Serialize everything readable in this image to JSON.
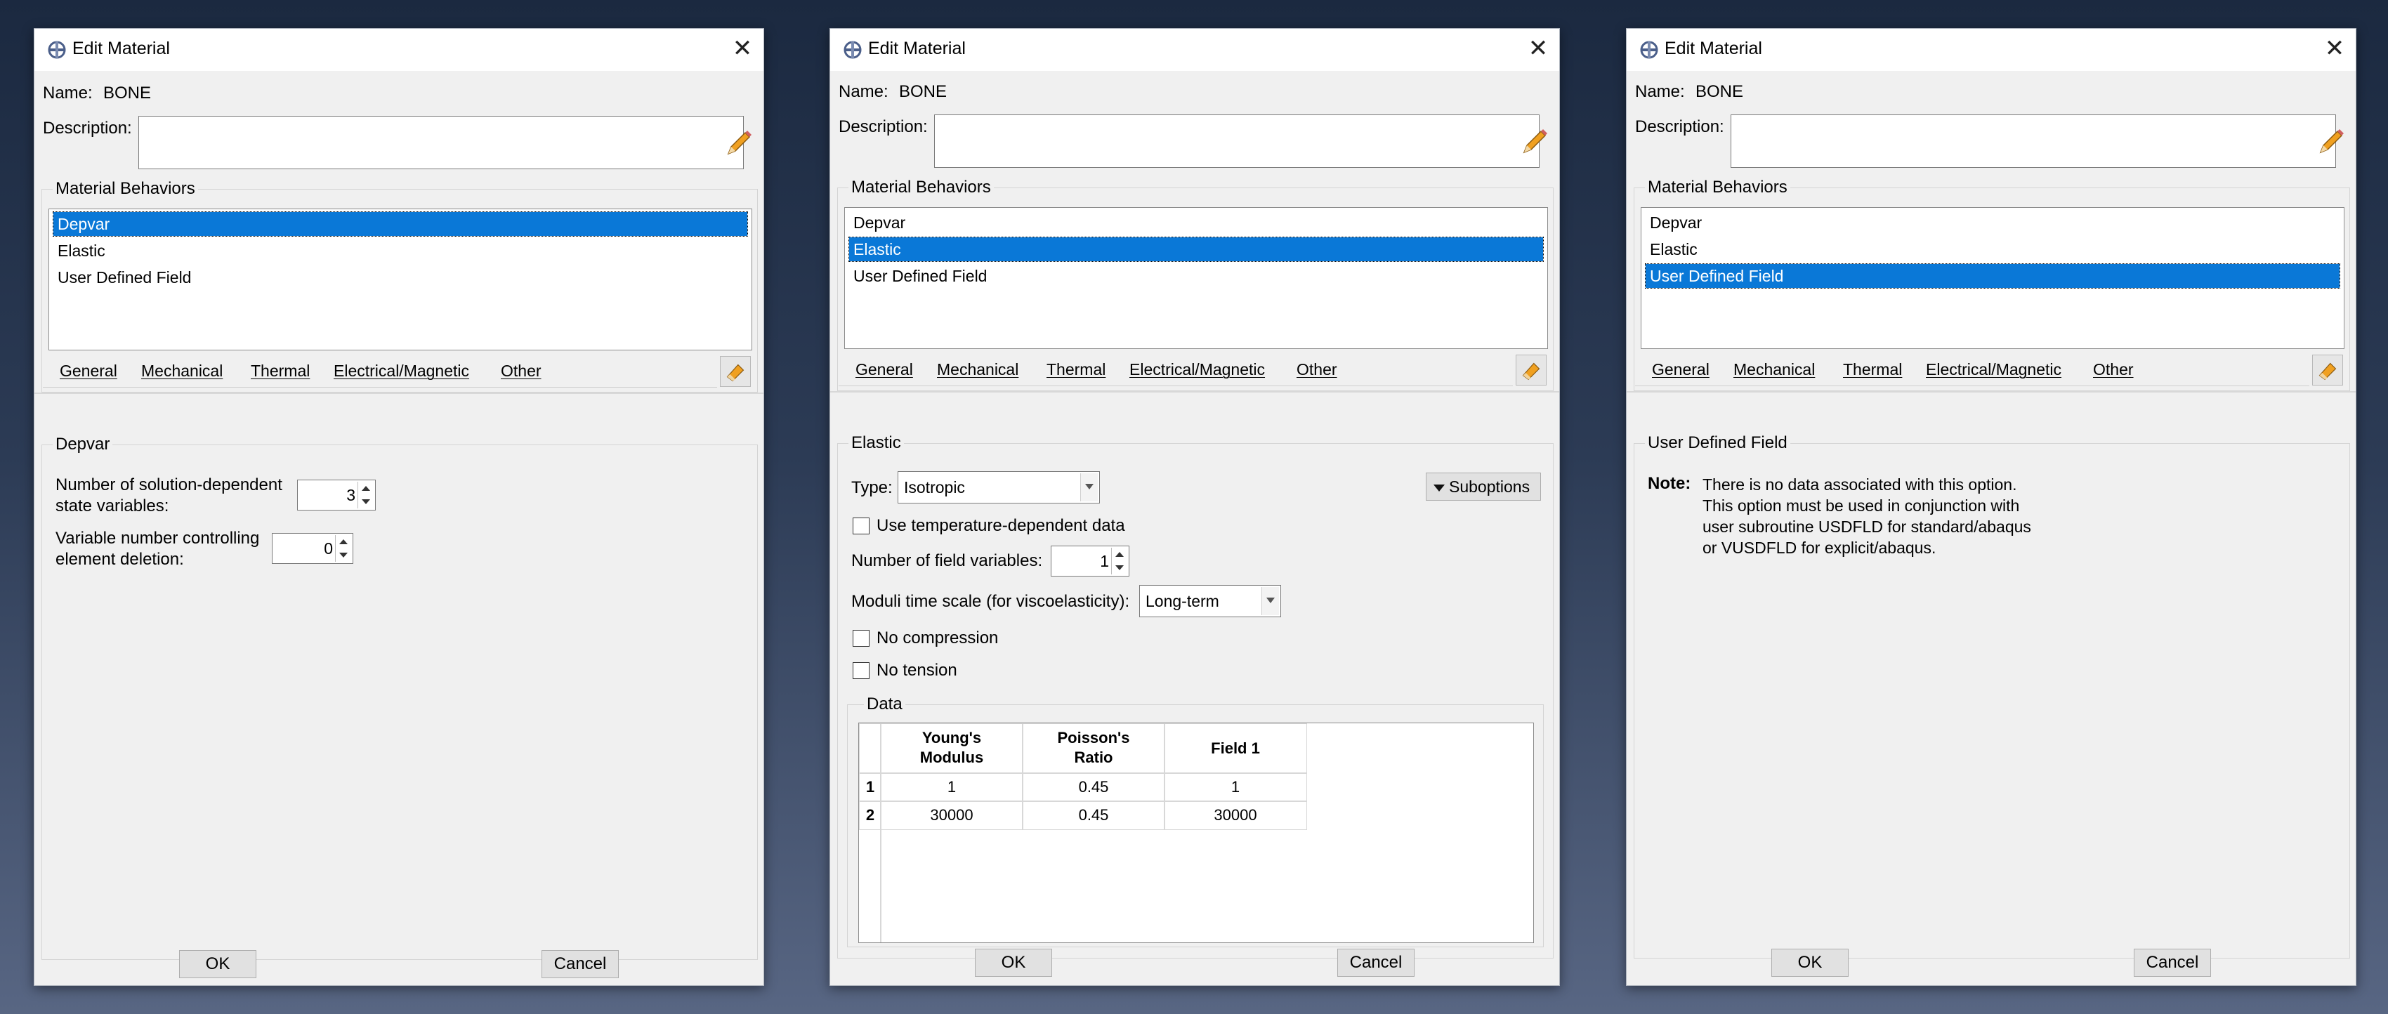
{
  "dialog": {
    "title": "Edit Material",
    "name_label": "Name:",
    "name_value": "BONE",
    "description_label": "Description:",
    "description_value": "",
    "behaviors_group": "Material Behaviors",
    "behaviors": [
      "Depvar",
      "Elastic",
      "User Defined Field"
    ],
    "menu": [
      "General",
      "Mechanical",
      "Thermal",
      "Electrical/Magnetic",
      "Other"
    ],
    "ok": "OK",
    "cancel": "Cancel",
    "selection_color": "#0a78d7"
  },
  "depvar": {
    "group": "Depvar",
    "nsdv_label_1": "Number of solution-dependent",
    "nsdv_label_2": "state variables:",
    "nsdv_value": "3",
    "del_label_1": "Variable number controlling",
    "del_label_2": "element deletion:",
    "del_value": "0"
  },
  "elastic": {
    "group": "Elastic",
    "type_label": "Type:",
    "type_value": "Isotropic",
    "suboptions": "Suboptions",
    "temp_dep": "Use temperature-dependent data",
    "field_vars_label": "Number of field variables:",
    "field_vars_value": "1",
    "moduli_label": "Moduli time scale (for viscoelasticity):",
    "moduli_value": "Long-term",
    "no_compression": "No compression",
    "no_tension": "No tension",
    "data_group": "Data",
    "columns": [
      [
        "Young's",
        "Modulus"
      ],
      [
        "Poisson's",
        "Ratio"
      ],
      [
        "Field 1",
        ""
      ]
    ],
    "rows": [
      {
        "num": "1",
        "cells": [
          "1",
          "0.45",
          "1"
        ]
      },
      {
        "num": "2",
        "cells": [
          "30000",
          "0.45",
          "30000"
        ]
      }
    ]
  },
  "udf": {
    "group": "User Defined Field",
    "note_label": "Note:",
    "note_lines": [
      "There is no data associated with this option.",
      "This option must be used in conjunction with",
      "user subroutine USDFLD for standard/abaqus",
      "or VUSDFLD for explicit/abaqus."
    ]
  }
}
